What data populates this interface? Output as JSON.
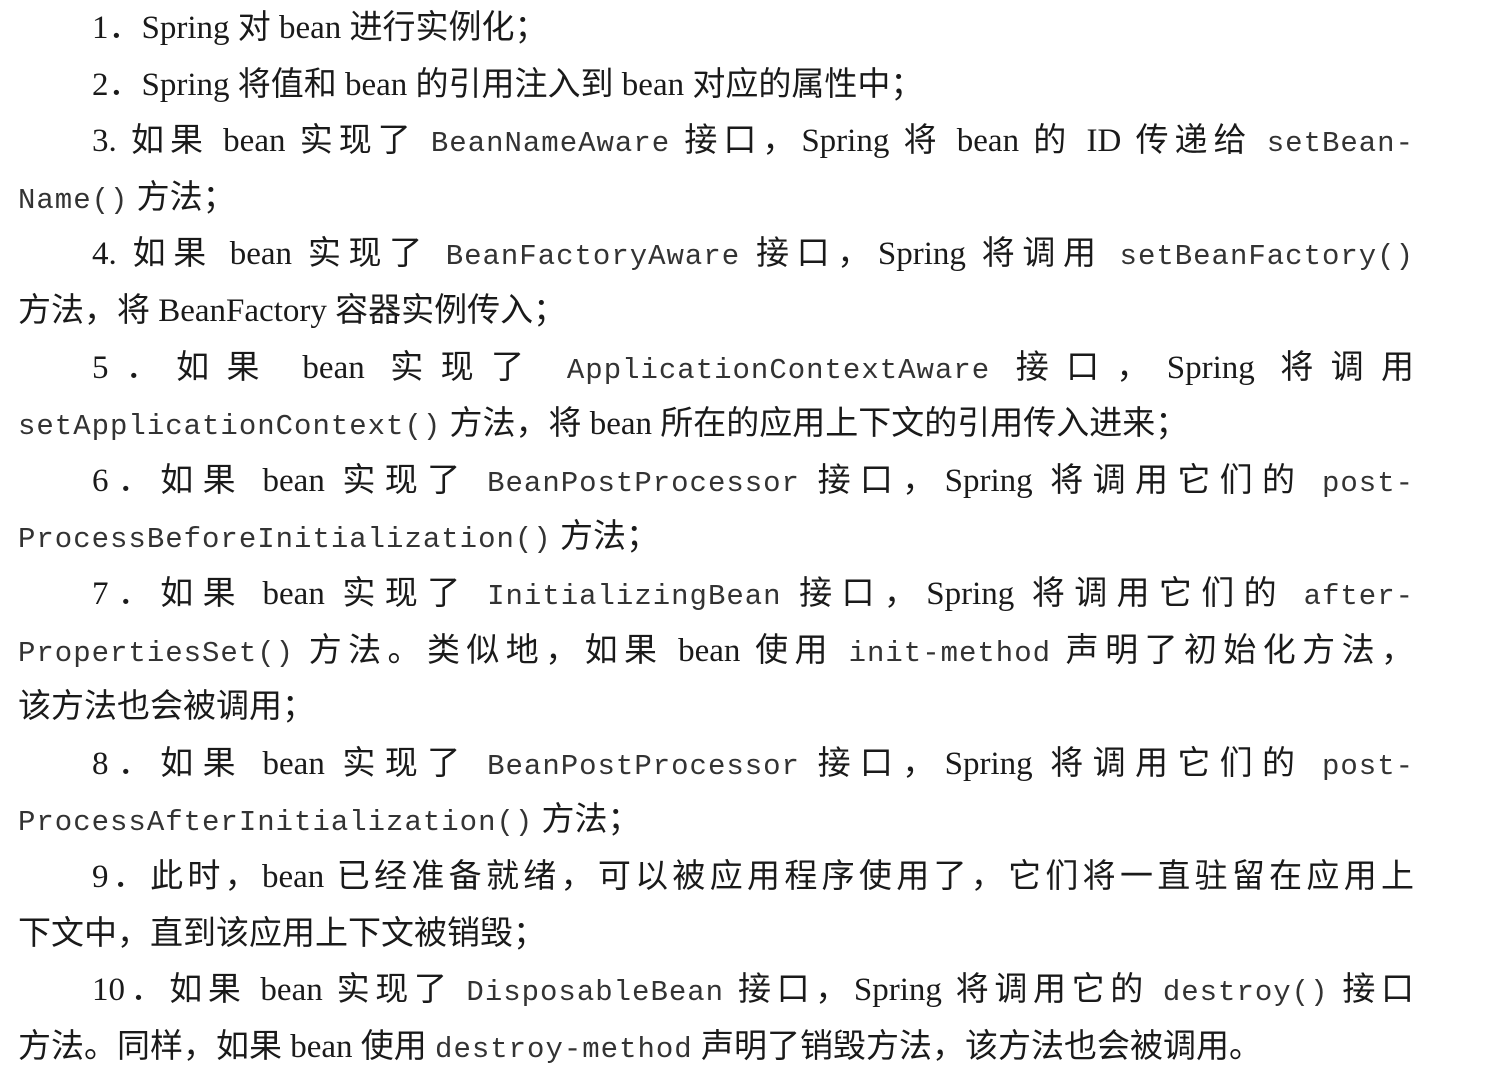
{
  "items": [
    {
      "lines": [
        [
          "1．Spring 对 bean 进行实例化；"
        ]
      ]
    },
    {
      "lines": [
        [
          "2．Spring 将值和 bean 的引用注入到 bean 对应的属性中；"
        ]
      ]
    },
    {
      "lines": [
        [
          "3. 如果 bean 实现了 ",
          {
            "code": "BeanNameAware"
          },
          " 接口，Spring 将 bean 的 ID 传递给 ",
          {
            "code": "setBean-"
          }
        ],
        [
          {
            "code": "Name()"
          },
          " 方法；"
        ]
      ]
    },
    {
      "lines": [
        [
          "4. 如果 bean 实现了 ",
          {
            "code": "BeanFactoryAware"
          },
          " 接口，Spring 将调用 ",
          {
            "code": "setBeanFactory()"
          }
        ],
        [
          "方法，将 BeanFactory 容器实例传入；"
        ]
      ]
    },
    {
      "lines": [
        [
          "5．如果 bean 实现了 ",
          {
            "code": "ApplicationContextAware"
          },
          " 接口，Spring 将调用"
        ],
        [
          {
            "code": "setApplicationContext()"
          },
          " 方法，将 bean 所在的应用上下文的引用传入进来；"
        ]
      ]
    },
    {
      "lines": [
        [
          "6．如果 bean 实现了 ",
          {
            "code": "BeanPostProcessor"
          },
          " 接口，Spring 将调用它们的 ",
          {
            "code": "post-"
          }
        ],
        [
          {
            "code": "ProcessBeforeInitialization()"
          },
          " 方法；"
        ]
      ]
    },
    {
      "lines": [
        [
          "7．如果 bean 实现了 ",
          {
            "code": "InitializingBean"
          },
          " 接口，Spring 将调用它们的 ",
          {
            "code": "after-"
          }
        ],
        [
          {
            "code": "PropertiesSet()"
          },
          " 方法。类似地，如果 bean 使用 ",
          {
            "code": "init-method"
          },
          " 声明了初始化方法，"
        ],
        [
          "该方法也会被调用；"
        ]
      ]
    },
    {
      "lines": [
        [
          "8．如果 bean 实现了 ",
          {
            "code": "BeanPostProcessor"
          },
          " 接口，Spring 将调用它们的 ",
          {
            "code": "post-"
          }
        ],
        [
          {
            "code": "ProcessAfterInitialization()"
          },
          " 方法；"
        ]
      ]
    },
    {
      "lines": [
        [
          "9．此时，bean 已经准备就绪，可以被应用程序使用了，它们将一直驻留在应用上"
        ],
        [
          "下文中，直到该应用上下文被销毁；"
        ]
      ]
    },
    {
      "lines": [
        [
          "10．如果 bean 实现了 ",
          {
            "code": "DisposableBean"
          },
          " 接口，Spring 将调用它的 ",
          {
            "code": "destroy()"
          },
          " 接口"
        ],
        [
          "方法。同样，如果 bean 使用 ",
          {
            "code": "destroy-method"
          },
          " 声明了销毁方法，该方法也会被调用。"
        ]
      ]
    }
  ]
}
